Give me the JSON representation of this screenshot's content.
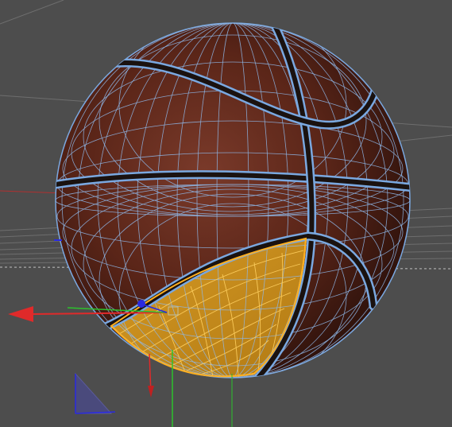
{
  "viewport": {
    "background": "#4d4d4d",
    "grid_color": "#8a8a8a",
    "horizon_color": "#9a9a9a"
  },
  "ball": {
    "name": "basketball",
    "material_color": "#5a2518",
    "seam_color": "#1a1210",
    "wireframe_color": "#8fb8e8",
    "selected_color": "#e8a92a",
    "selected_wire_color": "#ffc040"
  },
  "axes": {
    "x_color": "#e02a2a",
    "y_color": "#2cc22c",
    "z_color": "#2a2ae0"
  },
  "selection": {
    "panel": "yellow-highlighted-polygon-region"
  }
}
